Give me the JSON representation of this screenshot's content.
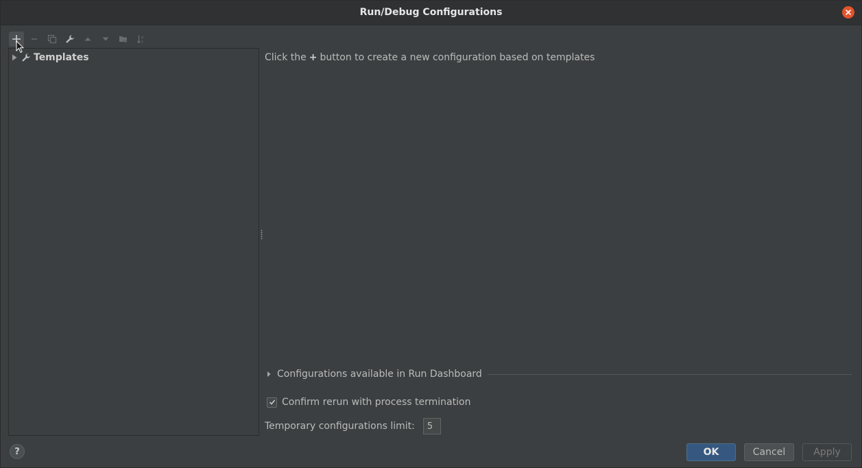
{
  "window": {
    "title": "Run/Debug Configurations"
  },
  "toolbar": {
    "buttons": [
      {
        "icon": "plus-icon",
        "label": "Add New Configuration"
      },
      {
        "icon": "minus-icon",
        "label": "Remove Configuration"
      },
      {
        "icon": "copy-icon",
        "label": "Copy Configuration"
      },
      {
        "icon": "wrench-icon",
        "label": "Edit Templates"
      },
      {
        "icon": "arrow-up-icon",
        "label": "Move Up"
      },
      {
        "icon": "arrow-down-icon",
        "label": "Move Down"
      },
      {
        "icon": "folder-add-icon",
        "label": "Create New Folder"
      },
      {
        "icon": "sort-az-icon",
        "label": "Sort Configurations"
      }
    ]
  },
  "tree": {
    "items": [
      {
        "label": "Templates",
        "icon": "wrench-icon",
        "expanded": false
      }
    ]
  },
  "main": {
    "hint_before": "Click the",
    "hint_plus": "+",
    "hint_after": "button to create a new configuration based on templates",
    "dashboard_label": "Configurations available in Run Dashboard",
    "confirm_label": "Confirm rerun with process termination",
    "confirm_checked": true,
    "limit_label": "Temporary configurations limit:",
    "limit_value": "5"
  },
  "footer": {
    "help_label": "?",
    "ok_label": "OK",
    "cancel_label": "Cancel",
    "apply_label": "Apply"
  },
  "colors": {
    "background": "#3c3f41",
    "titlebar": "#2f3133",
    "close": "#e2532c",
    "ok_button": "#365880",
    "text": "#bbbbbb"
  }
}
